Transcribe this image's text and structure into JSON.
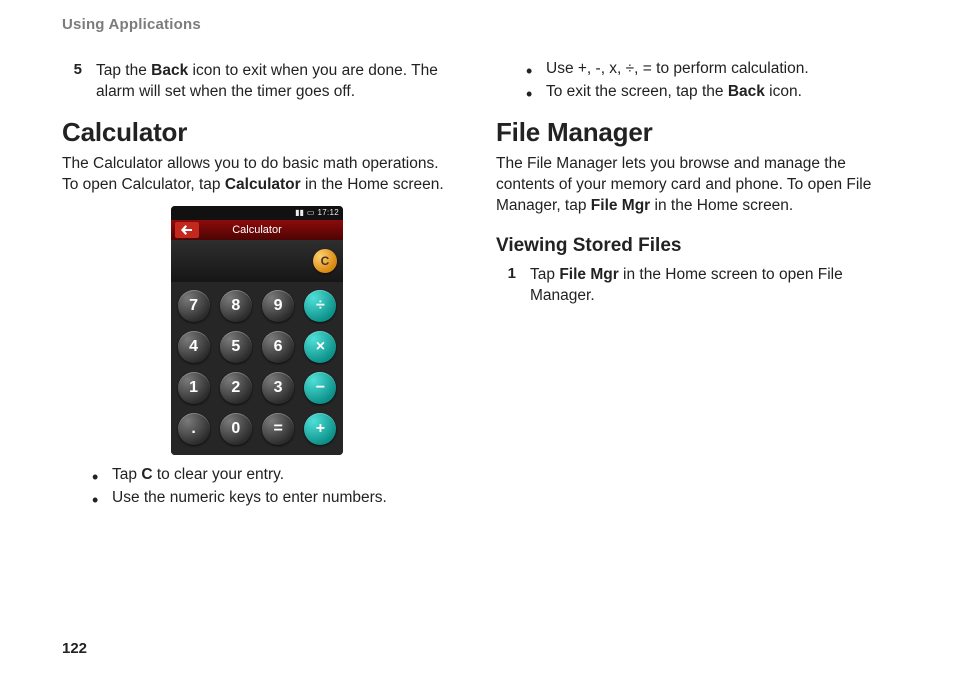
{
  "doc": {
    "running_head": "Using Applications",
    "page_number": "122"
  },
  "left": {
    "step5": {
      "num": "5",
      "pre": "Tap the ",
      "bold": "Back",
      "post": " icon to exit when you are done. The alarm will set when the timer goes off."
    },
    "calc_heading": "Calculator",
    "calc_intro": {
      "pre": "The Calculator allows you to do basic math operations. To open Calculator, tap ",
      "bold": "Calculator",
      "post": " in the Home screen."
    },
    "bullets": {
      "b1": {
        "pre": "Tap ",
        "bold": "C",
        "post": " to clear your entry."
      },
      "b2": "Use the numeric keys to enter numbers."
    },
    "phone": {
      "status_time": "17:12",
      "title": "Calculator",
      "clear": "C",
      "keys": {
        "k7": "7",
        "k8": "8",
        "k9": "9",
        "kdiv": "÷",
        "k4": "4",
        "k5": "5",
        "k6": "6",
        "kmul": "×",
        "k1": "1",
        "k2": "2",
        "k3": "3",
        "ksub": "−",
        "kdot": ".",
        "k0": "0",
        "keq": "=",
        "kadd": "+"
      }
    }
  },
  "right": {
    "bullets": {
      "b1": "Use +, -, x, ÷, = to perform calculation.",
      "b2": {
        "pre": "To exit the screen, tap the ",
        "bold": "Back",
        "post": " icon."
      }
    },
    "fm_heading": "File Manager",
    "fm_intro": {
      "pre": "The File Manager lets you browse and manage the contents of your memory card and phone. To open File Manager, tap ",
      "bold": "File Mgr",
      "post": " in the Home screen."
    },
    "sub_heading": "Viewing Stored Files",
    "step1": {
      "num": "1",
      "pre": "Tap ",
      "bold": "File Mgr",
      "post": " in the Home screen to open File Manager."
    }
  }
}
